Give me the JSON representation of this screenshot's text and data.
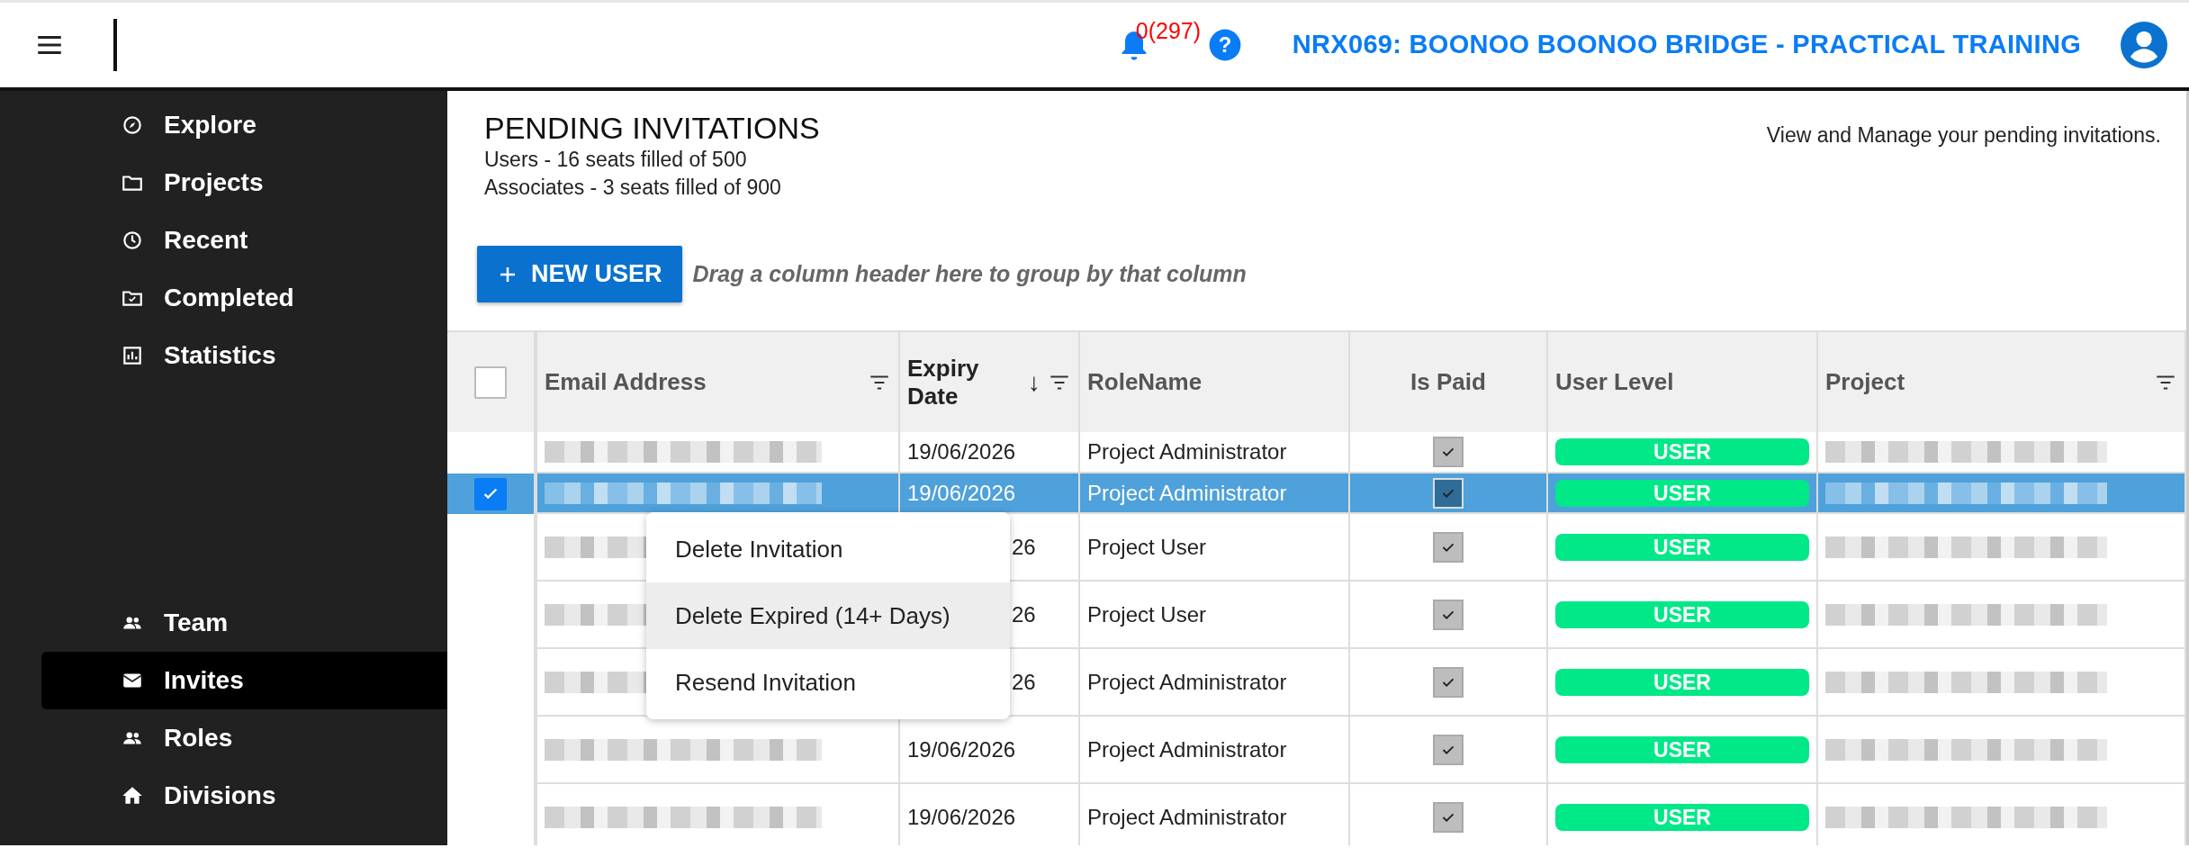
{
  "header": {
    "notification_count": "0(297)",
    "help_icon": "?",
    "project_title": "NRX069: BOONOO BOONOO BRIDGE - PRACTICAL TRAINING"
  },
  "sidebar": {
    "top_items": [
      {
        "label": "Explore",
        "kind": "compass",
        "selected": false
      },
      {
        "label": "Projects",
        "kind": "folder",
        "selected": false
      },
      {
        "label": "Recent",
        "kind": "clock",
        "selected": false
      },
      {
        "label": "Completed",
        "kind": "done",
        "selected": false
      },
      {
        "label": "Statistics",
        "kind": "chart",
        "selected": false
      }
    ],
    "bottom_items": [
      {
        "label": "Team",
        "kind": "people",
        "selected": false
      },
      {
        "label": "Invites",
        "kind": "mail",
        "selected": true
      },
      {
        "label": "Roles",
        "kind": "people",
        "selected": false
      },
      {
        "label": "Divisions",
        "kind": "home",
        "selected": false
      }
    ]
  },
  "page": {
    "title": "PENDING INVITATIONS",
    "seats": [
      "Users - 16 seats filled of 500",
      "Associates - 3 seats filled of 900"
    ],
    "description": "View and Manage your pending invitations."
  },
  "toolbar": {
    "new_button": "NEW USER",
    "group_hint": "Drag a column header here to group by that column"
  },
  "table": {
    "select_all": {
      "checked": false
    },
    "columns": [
      {
        "label": "Email Address",
        "filter": true
      },
      {
        "label": "Expiry Date",
        "filter": true,
        "sort": "↓"
      },
      {
        "label": "RoleName",
        "filter": false
      },
      {
        "label": "Is Paid",
        "filter": false
      },
      {
        "label": "User Level",
        "filter": false
      },
      {
        "label": "Project",
        "filter": true
      }
    ],
    "rows": [
      {
        "selected": false,
        "expiry": "19/06/2026",
        "covered": false,
        "role": "Project Administrator",
        "is_paid": true,
        "user_level": "USER"
      },
      {
        "selected": true,
        "expiry": "19/06/2026",
        "covered": false,
        "role": "Project Administrator",
        "is_paid": true,
        "user_level": "USER"
      },
      {
        "selected": false,
        "expiry": "26",
        "covered": true,
        "role": "Project User",
        "is_paid": true,
        "user_level": "USER"
      },
      {
        "selected": false,
        "expiry": "26",
        "covered": true,
        "role": "Project User",
        "is_paid": true,
        "user_level": "USER"
      },
      {
        "selected": false,
        "expiry": "26",
        "covered": true,
        "role": "Project Administrator",
        "is_paid": true,
        "user_level": "USER"
      },
      {
        "selected": false,
        "expiry": "19/06/2026",
        "covered": false,
        "role": "Project Administrator",
        "is_paid": true,
        "user_level": "USER"
      },
      {
        "selected": false,
        "expiry": "19/06/2026",
        "covered": false,
        "role": "Project Administrator",
        "is_paid": true,
        "user_level": "USER"
      }
    ]
  },
  "context_menu": {
    "items": [
      {
        "label": "Delete Invitation",
        "highlighted": false
      },
      {
        "label": "Delete Expired (14+ Days)",
        "highlighted": true
      },
      {
        "label": "Resend Invitation",
        "highlighted": false
      }
    ]
  }
}
